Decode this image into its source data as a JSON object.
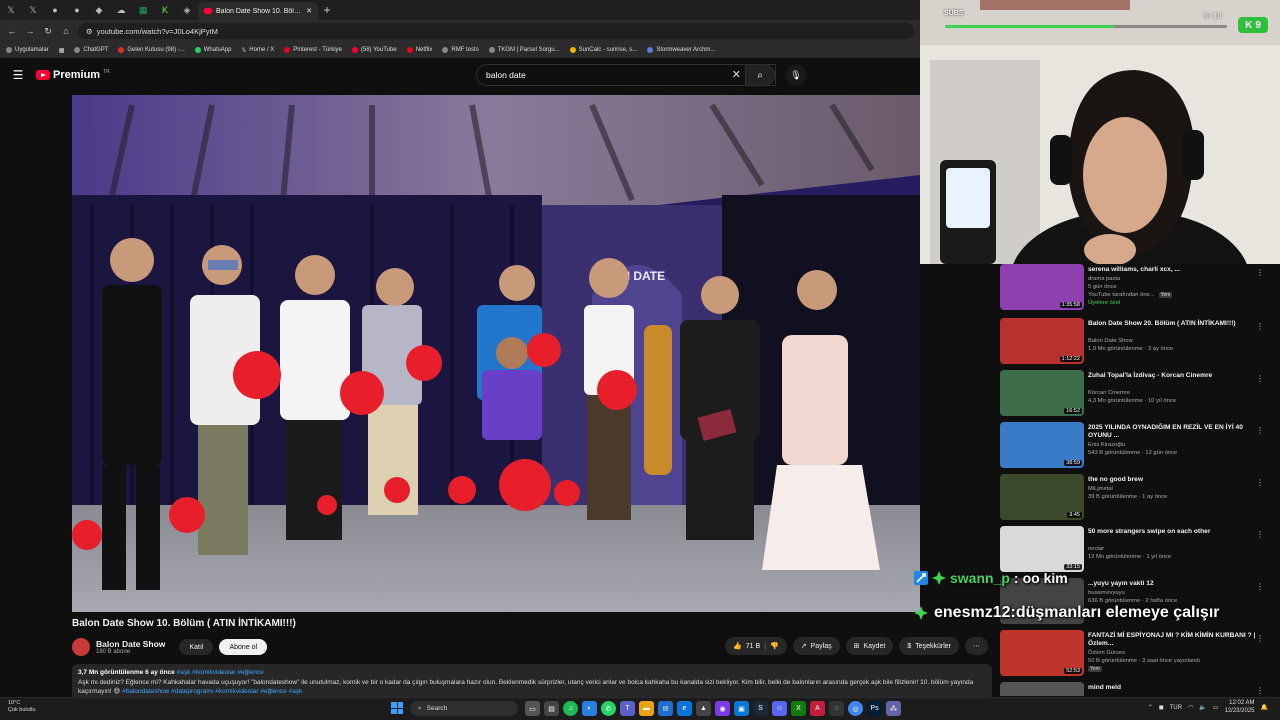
{
  "browser": {
    "tab_icons": [
      "x-icon",
      "x-icon",
      "github-icon",
      "github-icon",
      "tab-icon",
      "tab-icon",
      "sheet-icon",
      "k-icon",
      "tab-icon"
    ],
    "active_tab": "Balon Date Show 10. Bölüm ( A",
    "url": "youtube.com/watch?v=J0Lo4KjPytM",
    "bookmarks": [
      "Uygulamalar",
      "ChatGPT",
      "Gelen Kutusu (98) -...",
      "WhatsApp",
      "Home / X",
      "Pinterest - Türkiye",
      "(58) YouTube",
      "Netflix",
      "RMF tests",
      "TKGM | Parsel Sorgu...",
      "SunCalc - sunrise, s...",
      "Stormweaver Archm..."
    ]
  },
  "youtube": {
    "logo_text": "Premium",
    "logo_tr": "TR",
    "search_value": "balon date"
  },
  "video": {
    "title": "Balon Date Show 10. Bölüm ( ATIN İNTİKAMI!!!)",
    "channel": "Balon Date Show",
    "subscribers": "180 B abone",
    "join": "Katıl",
    "subscribe": "Abone ol",
    "likes": "71 B",
    "share": "Paylaş",
    "save": "Kaydet",
    "thanks": "Teşekkürler",
    "views_meta": "3,7 Mn görüntülenme  6 ay önce",
    "meta_tags": "#aşk #komikvideolar #eğlence",
    "description": "Aşk mı dediniz? Eğlence mi? Kahkahalar havada uçuşuyor! \"balondateshow\" ile unutulmaz, komik ve bir o kadar da çılgın buluşmalara hazır olun. Beklenmedik sürprizler, utanç verici anlar ve bolca kahkaha bu kanalda sizi bekliyor. Kim bilir, belki de balonların arasında gerçek aşk bile filizlenir! 10. bölüm yayında kaçırmayın! 😄",
    "desc_tags": "#balondateshow #dateprogramı #komikvideolar #eğlence #aşk"
  },
  "stream": {
    "subs_label": "SUBS",
    "subs_count": "6 / 10",
    "subs_progress": 0.6,
    "badge_value": "9"
  },
  "suggestions": [
    {
      "title": "serena williams, charli xcx, ...",
      "channel": "drama pasta",
      "meta": "5 gün önce",
      "extra": "YouTube tarafından öne...",
      "badge": "Yeni",
      "members": "Üyelere özel",
      "duration": "1:35:58",
      "thumb": "#8e3fb0"
    },
    {
      "title": "Balon Date Show 20. Bölüm ( ATIN İNTİKAMI!!!)",
      "channel": "Balon Date Show",
      "meta": "1,9 Mn görüntülenme · 3 ay önce",
      "duration": "1:12:22",
      "thumb": "#b8332f"
    },
    {
      "title": "Zuhal Topal'la İzdivaç - Korcan Cinemre",
      "channel": "Korcan Cinemre",
      "meta": "4,3 Mn görüntülenme · 10 yıl önce",
      "duration": "16:52",
      "thumb": "#3d6d4a"
    },
    {
      "title": "2025 YILINDA OYNADIĞIM EN REZİL VE EN İYİ 40 OYUNU ...",
      "channel": "Enis Kirazoğlu",
      "meta": "543 B görüntülenme · 12 gün önce",
      "duration": "38:59",
      "thumb": "#3a7bc8"
    },
    {
      "title": "the no good brew",
      "channel": "MiLjmetal",
      "meta": "39 B görüntülenme · 1 ay önce",
      "duration": "3:45",
      "thumb": "#3b4a2a"
    },
    {
      "title": "50 more strangers swipe on each other",
      "channel": "nectar",
      "meta": "12 Mn görüntülenme · 1 yıl önce",
      "duration": "33:15",
      "thumb": "#d9d9d9"
    },
    {
      "title": "...yuyu yayın vakti 12",
      "channel": "husamvivyuyu",
      "meta": "636 B görüntülenme · 2 hafta önce",
      "duration": "",
      "thumb": "#444"
    },
    {
      "title": "FANTAZİ Mİ ESPİYONAJ MI ? KİM KİMİN KURBANI ? | Özlem...",
      "channel": "Özlem Gürses",
      "meta": "50 B görüntülenme · 3 saat önce yayınlandı",
      "badge": "Yeni",
      "duration": "52:53",
      "thumb": "#c0352b"
    },
    {
      "title": "mind meld",
      "channel": "",
      "meta": "",
      "duration": "",
      "thumb": "#555"
    }
  ],
  "chat": [
    {
      "user": "swann_p",
      "sep": " : ",
      "message": "oo kim"
    },
    {
      "user": "enesmz12",
      "sep": " : ",
      "message": "düşmanları elemeye çalışır"
    }
  ],
  "taskbar": {
    "temp": "10°C",
    "weather": "Çok bulutlu",
    "search": "Search",
    "lang": "TUR",
    "time": "12:02 AM",
    "date": "12/23/2025"
  },
  "colors": {
    "yt_red": "#ff0033",
    "accent_green": "#2fbf3a",
    "link_blue": "#3ea6ff"
  }
}
